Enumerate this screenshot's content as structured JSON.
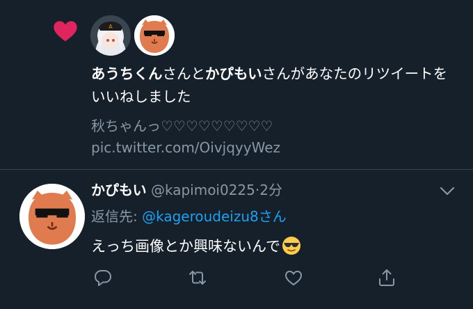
{
  "notification": {
    "icon": "heart-icon",
    "icon_color": "#e0245e",
    "actor1_name": "あうちくん",
    "connector1": "さんと",
    "actor2_name": "かぴもい",
    "connector2": "さんがあなたのリツイートをいいねしました",
    "quoted_text": "秋ちゃんっ♡♡♡♡♡♡♡♡♡",
    "quoted_link": "pic.twitter.com/OivjqyyWez"
  },
  "tweet": {
    "display_name": "かぴもい",
    "handle": "@kapimoi0225",
    "separator": "·",
    "time": "2分",
    "reply_label": "返信先: ",
    "reply_mention": "@kageroudeizu8さん",
    "body": "えっち画像とか興味ないんで",
    "emoji": "smiling-face-with-sunglasses",
    "actions": [
      "reply-icon",
      "retweet-icon",
      "like-icon",
      "share-icon"
    ]
  },
  "colors": {
    "background": "#15202b",
    "secondary_text": "#8899a6",
    "link": "#1da1f2",
    "divider": "#38444d"
  }
}
